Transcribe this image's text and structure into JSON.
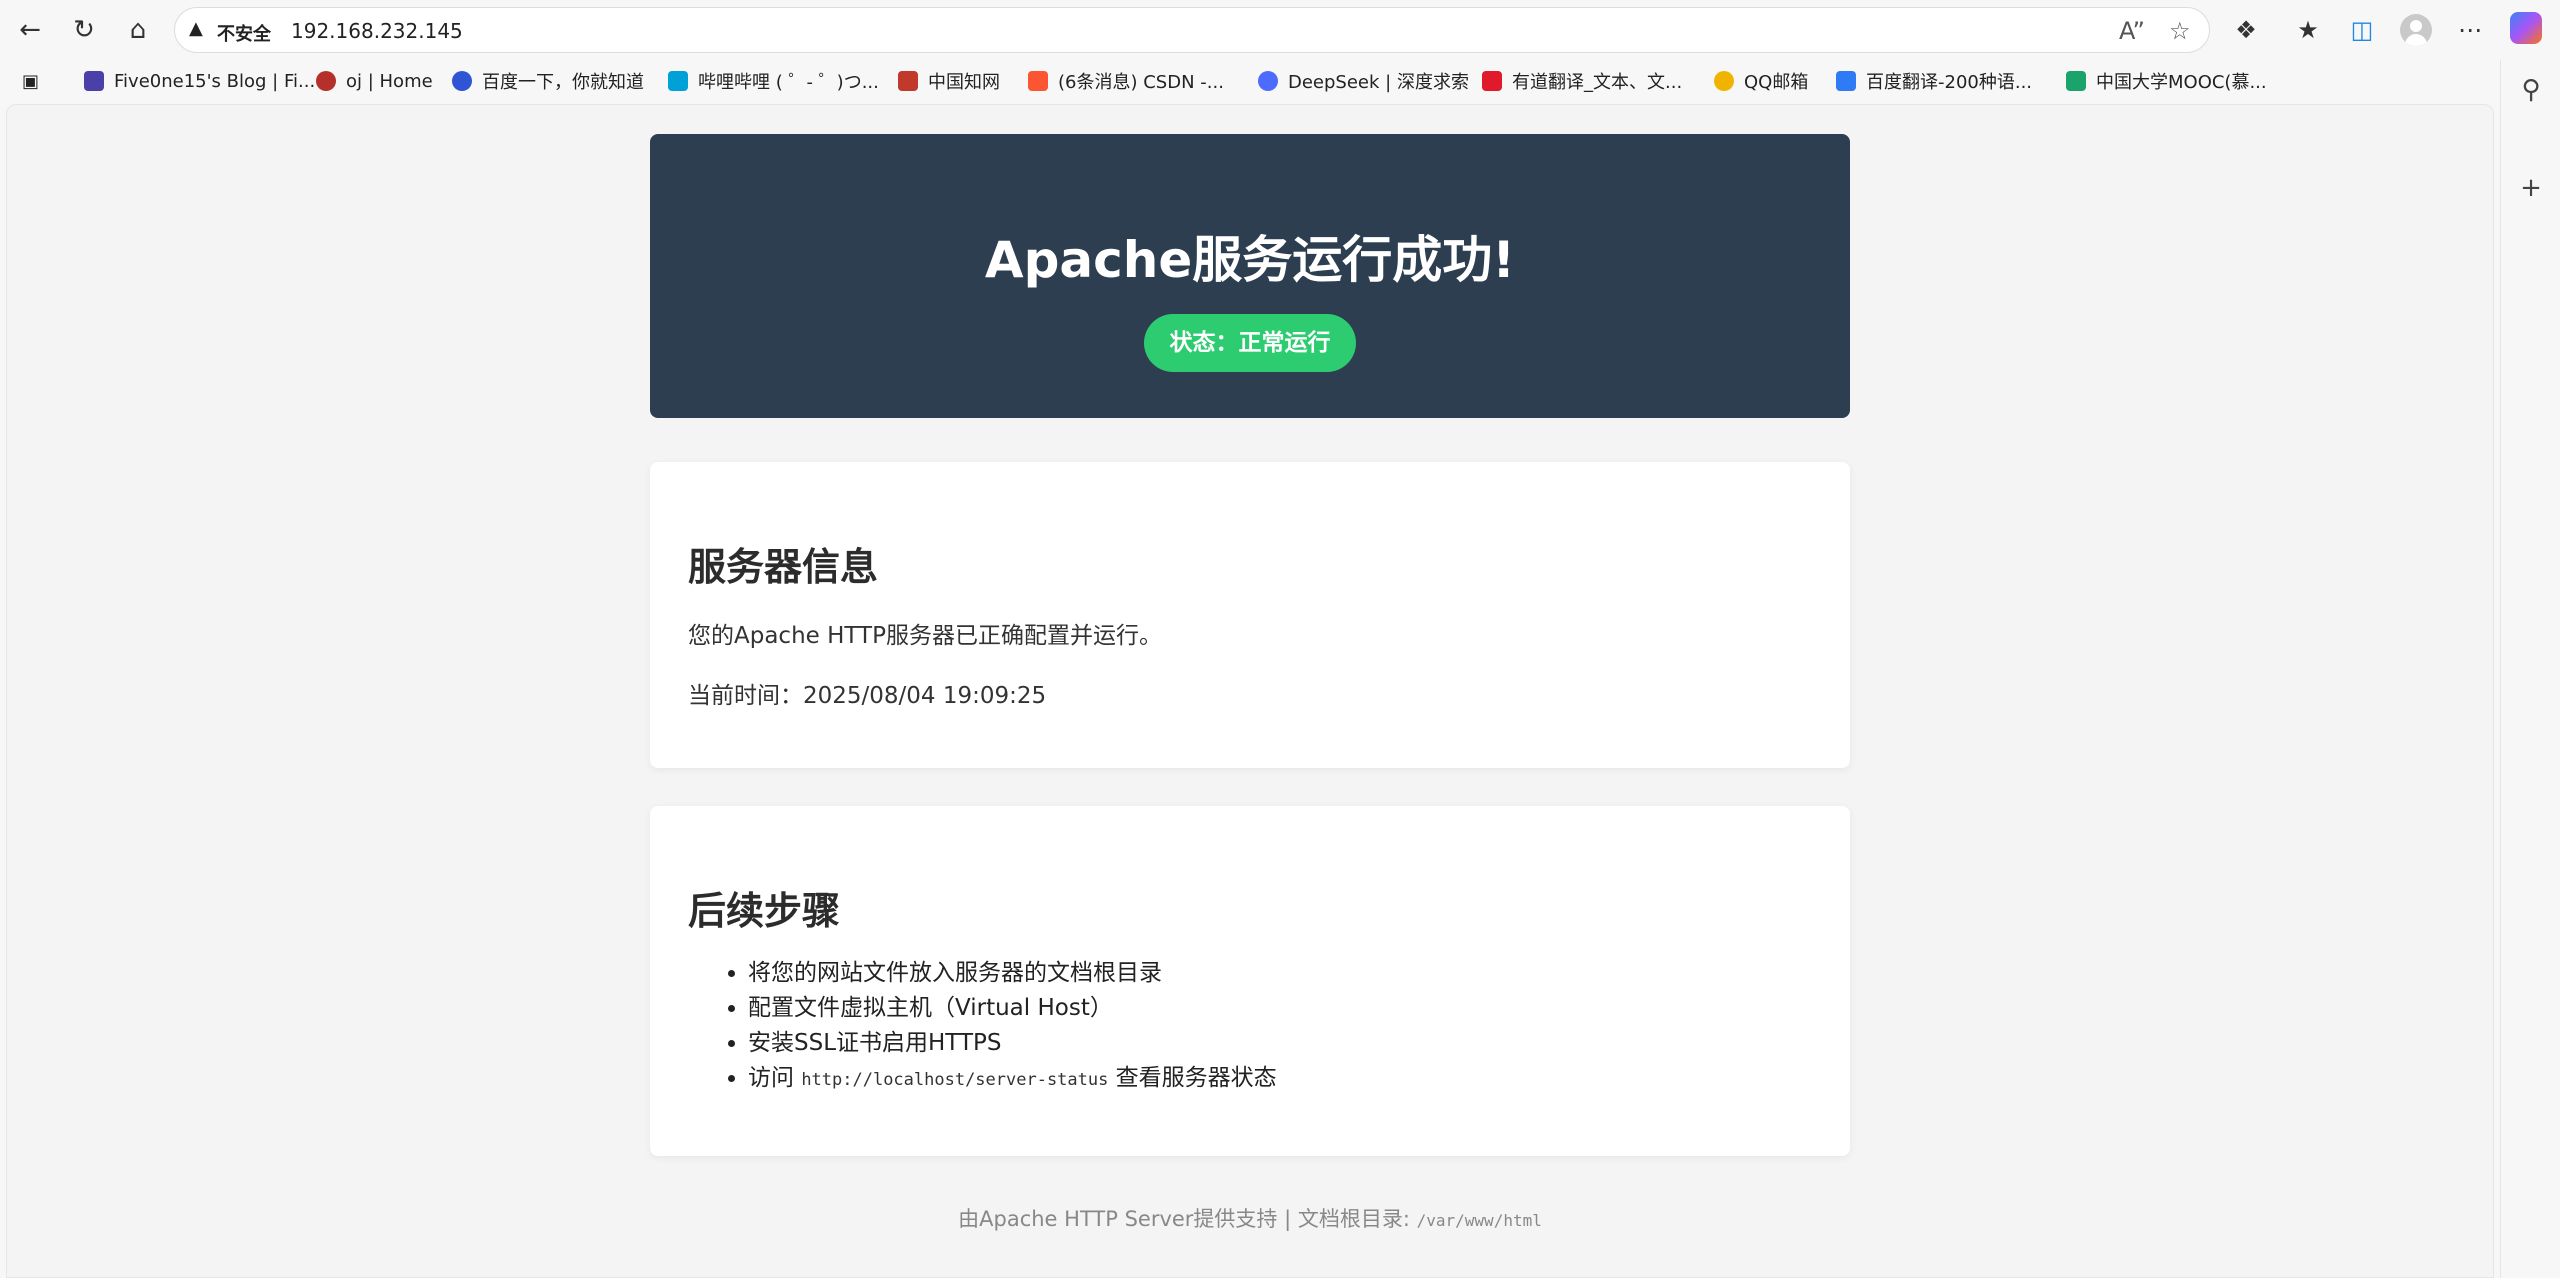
{
  "browser": {
    "security_label": "不安全",
    "url": "192.168.232.145"
  },
  "bookmarks": [
    {
      "label": "Five0ne15's Blog | Fi...",
      "color": "#4b3fa8"
    },
    {
      "label": "oj | Home",
      "color": "#b5302a"
    },
    {
      "label": "百度一下，你就知道",
      "color": "#2f55d4"
    },
    {
      "label": "哔哩哔哩 ( ゜- ゜)つ...",
      "color": "#00a1d6"
    },
    {
      "label": "中国知网",
      "color": "#c0392b"
    },
    {
      "label": "(6条消息) CSDN -...",
      "color": "#fc5531"
    },
    {
      "label": "DeepSeek | 深度求索",
      "color": "#4d6bfe"
    },
    {
      "label": "有道翻译_文本、文...",
      "color": "#e0192b"
    },
    {
      "label": "QQ邮箱",
      "color": "#f0b400"
    },
    {
      "label": "百度翻译-200种语...",
      "color": "#2f7bf5"
    },
    {
      "label": "中国大学MOOC(慕...",
      "color": "#1aa36b"
    }
  ],
  "page": {
    "header_title": "Apache服务运行成功!",
    "status": "状态：正常运行",
    "server_info": {
      "heading": "服务器信息",
      "line1": "您的Apache HTTP服务器已正确配置并运行。",
      "time_label": "当前时间：2025/08/04 19:09:25"
    },
    "next_steps": {
      "heading": "后续步骤",
      "items": [
        "将您的网站文件放入服务器的文档根目录",
        "配置文件虚拟主机（Virtual Host）",
        "安装SSL证书启用HTTPS"
      ],
      "visit_prefix": "访问 ",
      "visit_code": "http://localhost/server-status",
      "visit_suffix": " 查看服务器状态"
    },
    "footer_text": "由Apache HTTP Server提供支持 | 文档根目录: ",
    "footer_code": "/var/www/html"
  },
  "colors": {
    "header_bg": "#2c3e50",
    "status_green": "#2ecc71"
  }
}
